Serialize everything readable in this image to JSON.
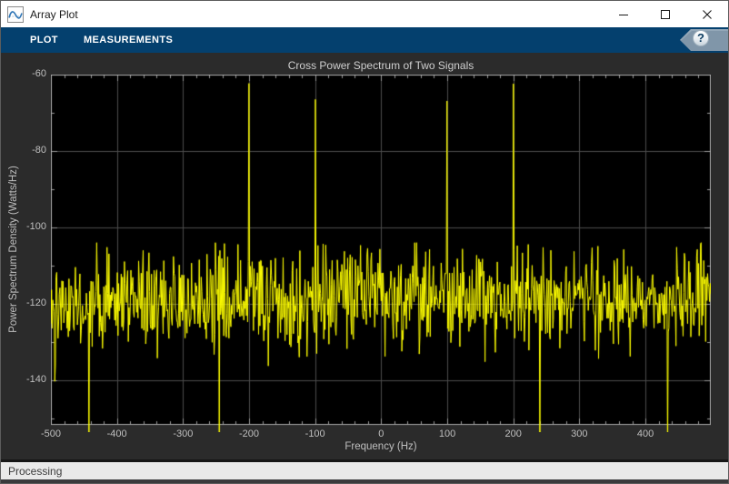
{
  "window": {
    "title": "Array Plot"
  },
  "icons": {
    "app": "sine-wave-icon",
    "minimize": "minimize-icon",
    "maximize": "maximize-icon",
    "close": "close-icon",
    "help": "question-mark-icon"
  },
  "toolstrip": {
    "tabs": [
      {
        "label": "PLOT"
      },
      {
        "label": "MEASUREMENTS"
      }
    ],
    "help_label": "?"
  },
  "statusbar": {
    "text": "Processing"
  },
  "colors": {
    "toolstrip_bg": "#04406e",
    "titlebar_bg": "#ffffff",
    "figure_bg": "#2b2b2b",
    "axes_bg": "#000000",
    "grid": "#4c4c4c",
    "frame": "#a8a8a8",
    "tick_text": "#bfbfbf",
    "line": "#ffff00",
    "status_bg": "#e9e9e9",
    "help_banner": "#8096a9"
  },
  "chart_data": {
    "type": "line",
    "title": "Cross Power Spectrum of Two Signals",
    "xlabel": "Frequency (Hz)",
    "ylabel": "Power Spectrum Density (Watts/Hz)",
    "xlim": [
      -500,
      499.02
    ],
    "ylim": [
      -151.7,
      -60
    ],
    "x_ticks": [
      -500,
      -400,
      -300,
      -200,
      -100,
      0,
      100,
      200,
      300,
      400
    ],
    "y_ticks": [
      -140,
      -120,
      -100,
      -80,
      -60
    ],
    "x_minor_step": 20,
    "y_minor_step": 10,
    "grid": true,
    "legend": "none",
    "line_color": "#ffff00",
    "series_description": "Cross power spectral density: dense noise floor around -119 dB with four sinusoid peaks and four deep nulls dropping below the axis",
    "noise_floor": {
      "mean_db": -119,
      "std_db": 6.5,
      "max_db": -104,
      "min_db": -148,
      "points": 1024,
      "seed": 42
    },
    "peaks": [
      {
        "freq_hz": -200,
        "level_db": -62.3
      },
      {
        "freq_hz": -100,
        "level_db": -66.5
      },
      {
        "freq_hz": 100,
        "level_db": -66.9
      },
      {
        "freq_hz": 200,
        "level_db": -62.4
      }
    ],
    "deep_nulls": [
      {
        "freq_hz": -442,
        "level_db": -160
      },
      {
        "freq_hz": -245,
        "level_db": -160
      },
      {
        "freq_hz": 240,
        "level_db": -160
      },
      {
        "freq_hz": 434,
        "level_db": -160
      }
    ]
  }
}
